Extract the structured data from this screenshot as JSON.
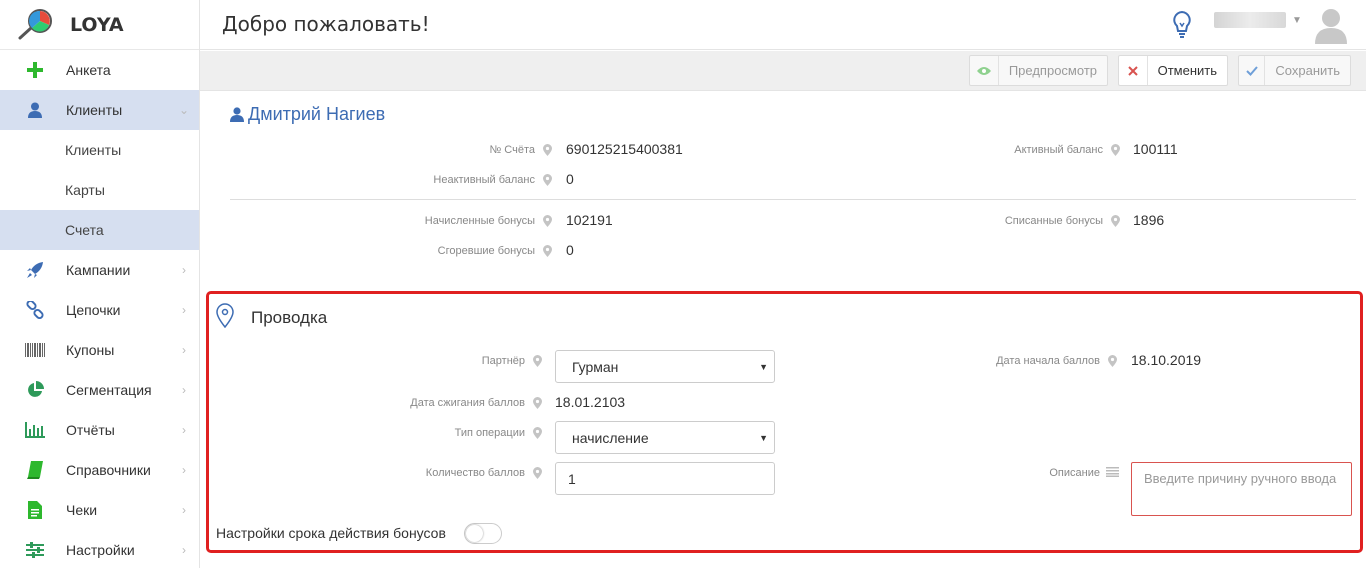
{
  "app": {
    "name": "LOYA"
  },
  "header": {
    "title": "Добро пожаловать!"
  },
  "sidebar": {
    "items": [
      {
        "label": "Анкета",
        "icon": "plus-icon"
      },
      {
        "label": "Клиенты",
        "icon": "user-icon",
        "active": true
      },
      {
        "label": "Кампании",
        "icon": "rocket-icon"
      },
      {
        "label": "Цепочки",
        "icon": "link-icon"
      },
      {
        "label": "Купоны",
        "icon": "barcode-icon"
      },
      {
        "label": "Сегментация",
        "icon": "pie-chart-icon"
      },
      {
        "label": "Отчёты",
        "icon": "bar-chart-icon"
      },
      {
        "label": "Справочники",
        "icon": "book-icon"
      },
      {
        "label": "Чеки",
        "icon": "document-icon"
      },
      {
        "label": "Настройки",
        "icon": "sliders-icon"
      }
    ],
    "subitems": [
      {
        "label": "Клиенты"
      },
      {
        "label": "Карты"
      },
      {
        "label": "Счета",
        "active": true
      }
    ]
  },
  "toolbar": {
    "preview_label": "Предпросмотр",
    "cancel_label": "Отменить",
    "save_label": "Сохранить"
  },
  "client": {
    "name": "Дмитрий Нагиев",
    "account_number_label": "№ Счёта",
    "account_number": "690125215400381",
    "inactive_balance_label": "Неактивный баланс",
    "inactive_balance": "0",
    "active_balance_label": "Активный баланс",
    "active_balance": "100111",
    "accrued_bonuses_label": "Начисленные бонусы",
    "accrued_bonuses": "102191",
    "burned_bonuses_label": "Сгоревшие бонусы",
    "burned_bonuses": "0",
    "spent_bonuses_label": "Списанные бонусы",
    "spent_bonuses": "1896"
  },
  "provodka": {
    "title": "Проводка",
    "partner_label": "Партнёр",
    "partner_value": "Гурман",
    "start_date_label": "Дата начала баллов",
    "start_date": "18.10.2019",
    "burn_date_label": "Дата сжигания баллов",
    "burn_date": "18.01.2103",
    "op_type_label": "Тип операции",
    "op_type_value": "начисление",
    "points_label": "Количество баллов",
    "points_value": "1",
    "description_label": "Описание",
    "description_placeholder": "Введите причину ручного ввода",
    "validity_toggle_label": "Настройки срока действия бонусов"
  },
  "colors": {
    "accent": "#3d6cb3",
    "active_nav": "#d6dff0",
    "error_border": "#e02020"
  }
}
